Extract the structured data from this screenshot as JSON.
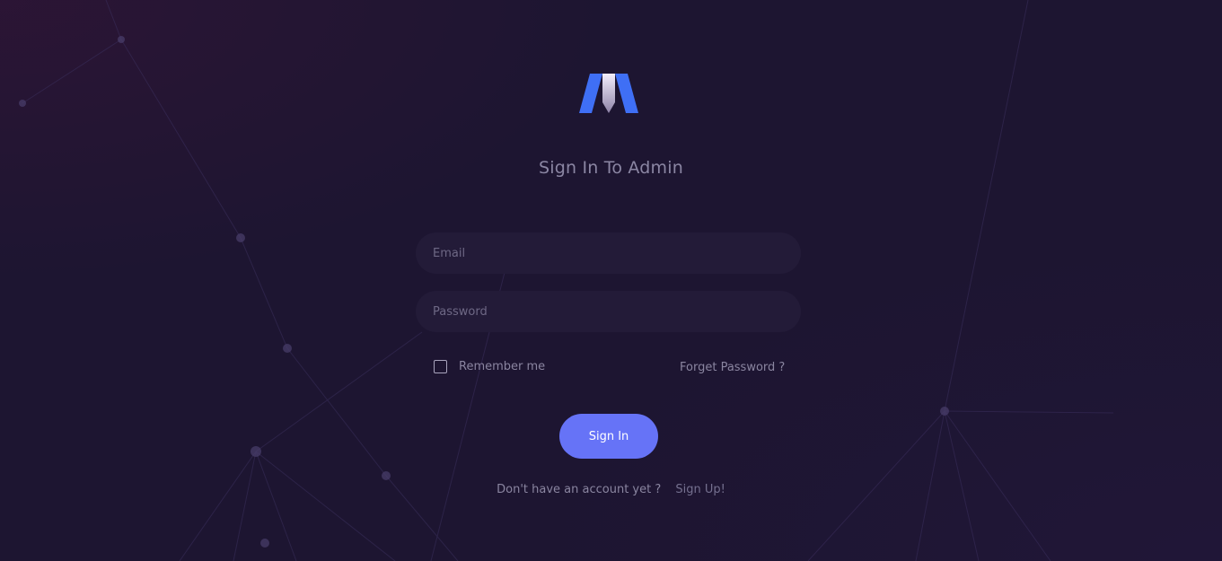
{
  "title": "Sign In To Admin",
  "form": {
    "email_placeholder": "Email",
    "password_placeholder": "Password",
    "remember_label": "Remember me",
    "remember_checked": false,
    "forgot_label": "Forget Password ?",
    "signin_label": "Sign In"
  },
  "footer": {
    "no_account_text": "Don't have an account yet ?",
    "signup_label": "Sign Up!"
  },
  "icons": {
    "logo": "brand-logo-icon",
    "checkbox": "checkbox-icon"
  },
  "colors": {
    "background": "#1d1531",
    "field_background": "#231b38",
    "accent": "#6673f7",
    "logo_blue": "#3f6ff5",
    "text_muted": "#8a85a0"
  }
}
